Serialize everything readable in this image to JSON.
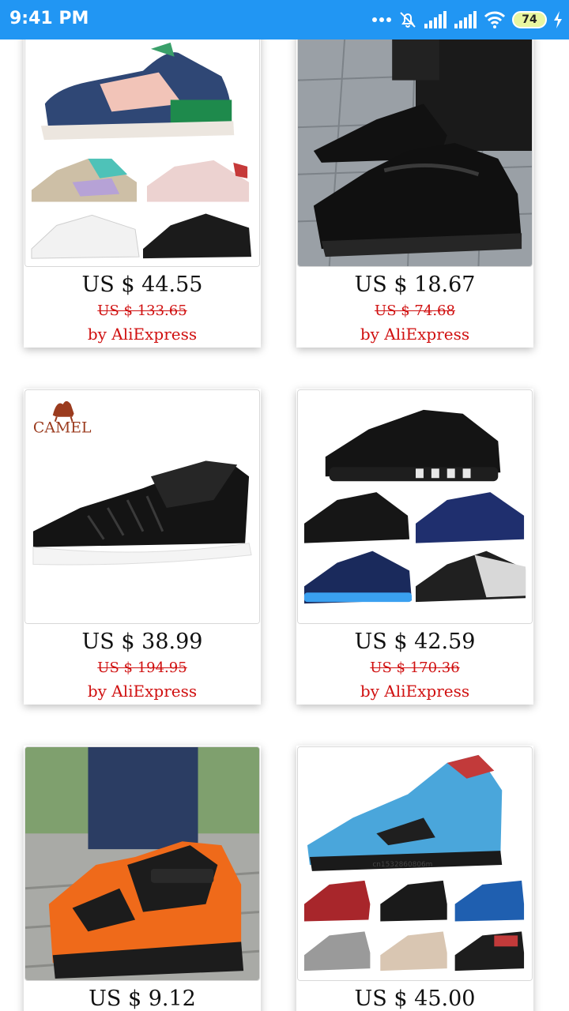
{
  "status_bar": {
    "time": "9:41 PM",
    "battery": "74",
    "icons": [
      "more-dots-icon",
      "alarm-off-icon",
      "signal-icon",
      "signal-icon",
      "wifi-icon",
      "battery-icon",
      "charging-icon"
    ]
  },
  "products": [
    {
      "price": "US $ 44.55",
      "old_price": "US $ 133.65",
      "seller": "by AliExpress"
    },
    {
      "price": "US $ 18.67",
      "old_price": "US $ 74.68",
      "seller": "by AliExpress"
    },
    {
      "price": "US $ 38.99",
      "old_price": "US $ 194.95",
      "seller": "by AliExpress",
      "brand": "CAMEL"
    },
    {
      "price": "US $ 42.59",
      "old_price": "US $ 170.36",
      "seller": "by AliExpress"
    },
    {
      "price": "US $ 9.12"
    },
    {
      "price": "US $ 45.00",
      "watermark": "cn1532860806m"
    }
  ],
  "colors": {
    "status_bar": "#2196f3",
    "old_price": "#d01010",
    "seller": "#d01010"
  }
}
